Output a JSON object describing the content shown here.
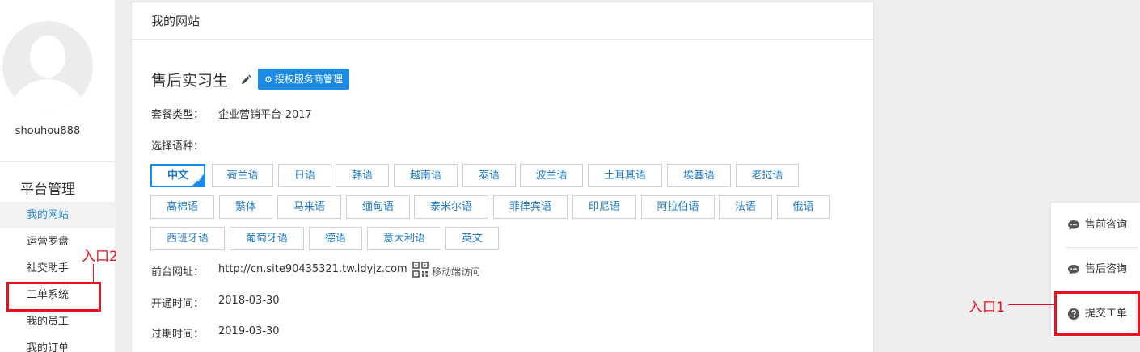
{
  "sidebar": {
    "username": "shouhou888",
    "section_title": "平台管理",
    "items": [
      {
        "label": "我的网站"
      },
      {
        "label": "运营罗盘"
      },
      {
        "label": "社交助手"
      },
      {
        "label": "工单系统"
      },
      {
        "label": "我的员工"
      },
      {
        "label": "我的订单"
      }
    ]
  },
  "panel": {
    "title": "我的网站",
    "site_name": "售后实习生",
    "auth_button": "授权服务商管理",
    "package_label": "套餐类型：",
    "package_value": "企业营销平台-2017",
    "language_label": "选择语种：",
    "languages_row1": [
      "中文",
      "荷兰语",
      "日语",
      "韩语",
      "越南语",
      "泰语",
      "波兰语",
      "土耳其语",
      "埃塞语",
      "老挝语"
    ],
    "languages_row2": [
      "高棉语",
      "繁体",
      "马来语",
      "缅甸语",
      "泰米尔语",
      "菲律宾语",
      "印尼语",
      "阿拉伯语",
      "法语",
      "俄语"
    ],
    "languages_row3": [
      "西班牙语",
      "葡萄牙语",
      "德语",
      "意大利语",
      "英文"
    ],
    "selected_language": "中文",
    "url_label": "前台网址：",
    "url_value": "http://cn.site90435321.tw.ldyjz.com",
    "mobile_access": "移动端访问",
    "open_label": "开通时间：",
    "open_value": "2018-03-30",
    "expire_label": "过期时间：",
    "expire_value": "2019-03-30"
  },
  "float_panel": {
    "items": [
      {
        "label": "售前咨询",
        "icon": "chat-bubble-icon"
      },
      {
        "label": "售后咨询",
        "icon": "chat-bubble-icon"
      },
      {
        "label": "提交工单",
        "icon": "question-circle-icon"
      }
    ]
  },
  "annotations": {
    "entry1": "入口1",
    "entry2": "入口2",
    "color": "#e8121e"
  },
  "colors": {
    "accent": "#1a8be8",
    "link": "#1f7ac4"
  }
}
